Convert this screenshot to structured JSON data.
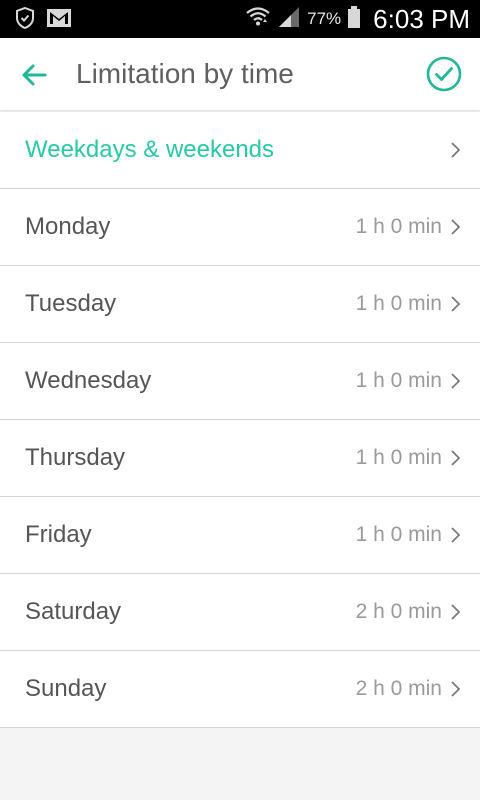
{
  "status_bar": {
    "battery_percent": "77%",
    "time": "6:03 PM",
    "icons": [
      "shield-icon",
      "gmail-icon",
      "wifi-icon",
      "signal-icon",
      "battery-icon"
    ]
  },
  "app_bar": {
    "title": "Limitation by time",
    "back_icon": "arrow-left-icon",
    "confirm_icon": "check-circle-icon"
  },
  "colors": {
    "accent": "#27c9a6",
    "text_primary": "#555555",
    "text_secondary": "#9a9a9a",
    "background": "#f4f4f4"
  },
  "list": {
    "header_row": {
      "label": "Weekdays & weekends"
    },
    "days": [
      {
        "label": "Monday",
        "value": "1 h 0 min"
      },
      {
        "label": "Tuesday",
        "value": "1 h 0 min"
      },
      {
        "label": "Wednesday",
        "value": "1 h 0 min"
      },
      {
        "label": "Thursday",
        "value": "1 h 0 min"
      },
      {
        "label": "Friday",
        "value": "1 h 0 min"
      },
      {
        "label": "Saturday",
        "value": "2 h 0 min"
      },
      {
        "label": "Sunday",
        "value": "2 h 0 min"
      }
    ]
  }
}
